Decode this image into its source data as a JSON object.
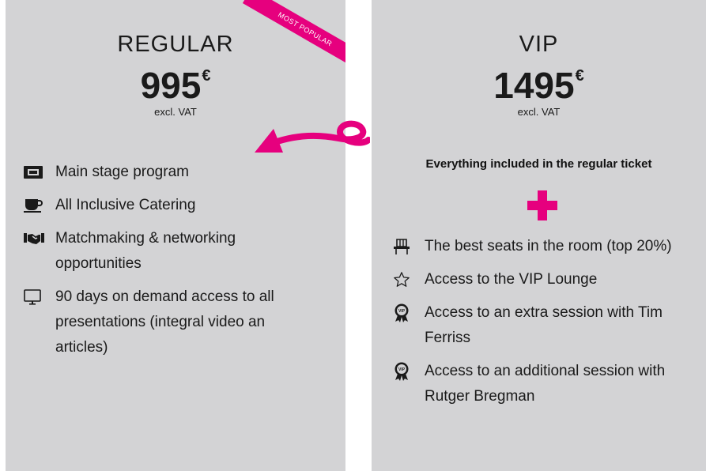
{
  "regular": {
    "name": "REGULAR",
    "price": "995",
    "currency": "€",
    "vat": "excl. VAT",
    "badge": "MOST POPULAR",
    "features": [
      {
        "icon": "ticket-icon",
        "text": "Main stage program"
      },
      {
        "icon": "coffee-cup-icon",
        "text": "All Inclusive Catering"
      },
      {
        "icon": "handshake-icon",
        "text": "Matchmaking & networking opportunities"
      },
      {
        "icon": "monitor-icon",
        "text": "90 days on demand access to all presentations (integral video an articles)"
      }
    ]
  },
  "vip": {
    "name": "VIP",
    "price": "1495",
    "currency": "€",
    "vat": "excl. VAT",
    "included": "Everything included in the regular ticket",
    "features": [
      {
        "icon": "chair-icon",
        "text": "The best seats in the room (top 20%)"
      },
      {
        "icon": "star-icon",
        "text": "Access to the VIP Lounge"
      },
      {
        "icon": "vip-badge-icon",
        "text": "Access to an extra session with Tim Ferriss"
      },
      {
        "icon": "vip-badge-icon",
        "text": "Access to an additional session with Rutger Bregman"
      }
    ]
  },
  "colors": {
    "accent": "#e6007e",
    "card": "#d3d3d5",
    "text": "#1a1a1a"
  }
}
